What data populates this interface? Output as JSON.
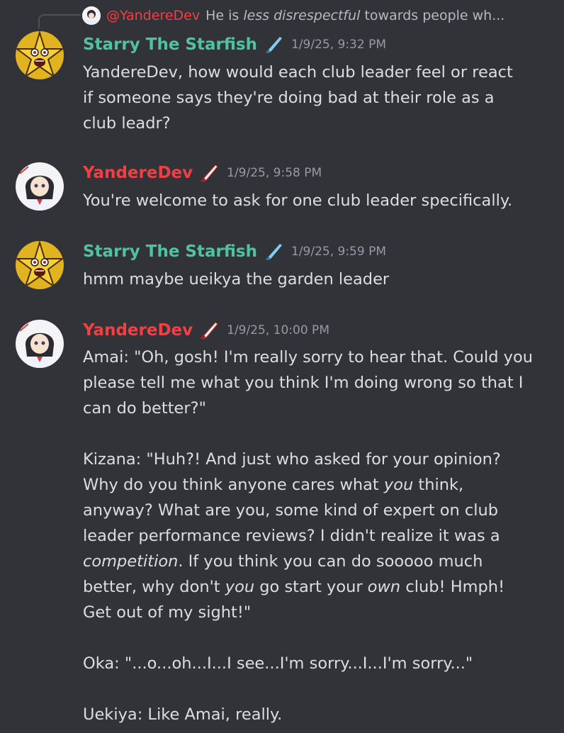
{
  "reply": {
    "author": "@YandereDev",
    "text_before": "He is ",
    "text_em": "less disrespectful",
    "text_after": " towards people wh..."
  },
  "messages": [
    {
      "author": "Starry The Starfish",
      "time": "1/9/25, 9:32 PM",
      "lines": [
        "YandereDev, how would each club leader feel or react",
        "if someone says they're doing bad at their role as a",
        "club leadr?"
      ]
    },
    {
      "author": "YandereDev",
      "time": "1/9/25, 9:58 PM",
      "lines": [
        "You're welcome to ask for one club leader specifically."
      ]
    },
    {
      "author": "Starry The Starfish",
      "time": "1/9/25, 9:59 PM",
      "lines": [
        "hmm maybe ueikya the garden leader"
      ]
    },
    {
      "author": "YandereDev",
      "time": "1/9/25, 10:00 PM",
      "amai": [
        "Amai: \"Oh, gosh! I'm really sorry to hear that. Could you",
        "please tell me what you think I'm doing wrong so that I",
        "can do better?\""
      ],
      "kizana": {
        "l1": "Kizana: \"Huh?! And just who asked for your opinion?",
        "l2_a": "Why do you think anyone cares what ",
        "l2_em": "you",
        "l2_b": " think,",
        "l3": "anyway? What are you, some kind of expert on club",
        "l4": "leader performance reviews? I didn't realize it was a",
        "l5_em": "competition",
        "l5_b": ". If you think you can do sooooo much",
        "l6_a": "better, why don't ",
        "l6_em1": "you",
        "l6_b": " go start your ",
        "l6_em2": "own",
        "l6_c": " club! Hmph!",
        "l7": "Get out of my sight!\""
      },
      "oka": "Oka: \"...o...oh...I...I see...I'm sorry...I...I'm sorry...\"",
      "uekiya": "Uekiya: Like Amai, really."
    }
  ],
  "colors": {
    "background": "#323339",
    "starry_name": "#4fc3a1",
    "dev_name": "#f23f43",
    "text": "#dbdee1",
    "timestamp": "#949ba4"
  },
  "icons": {
    "starry_badge": "blue-knife-icon",
    "dev_badge": "red-knife-icon"
  }
}
